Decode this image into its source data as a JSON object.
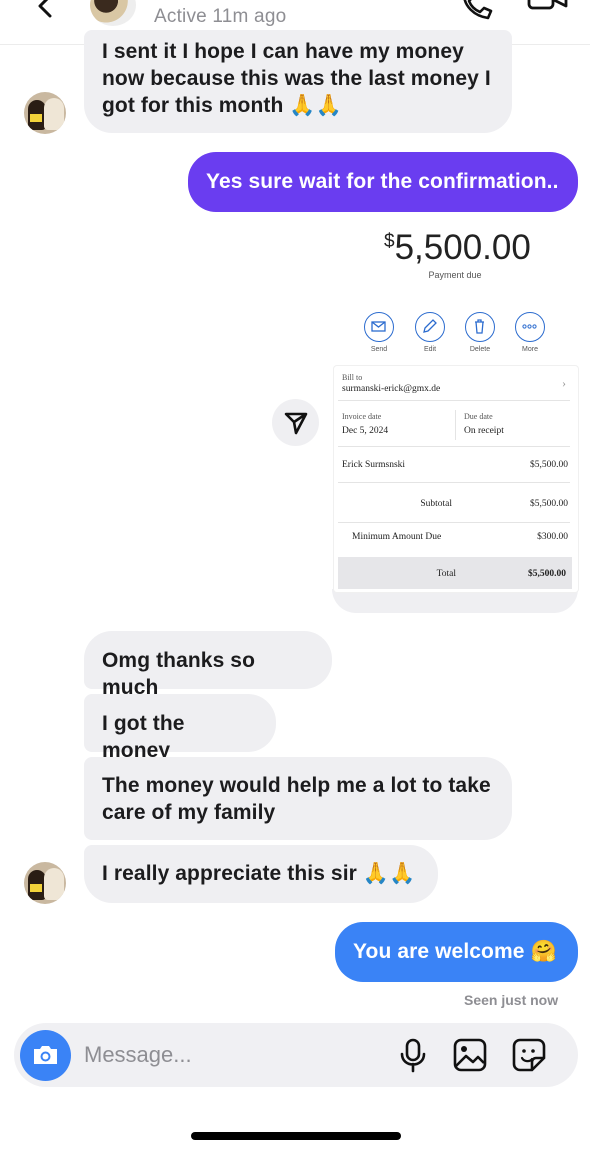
{
  "header": {
    "status": "Active 11m ago"
  },
  "messages": [
    {
      "from": "them",
      "lines": [
        "I sent it I hope I can have my money",
        "now because this was the last money I",
        "got for this month"
      ],
      "emoji": "🙏🙏"
    },
    {
      "from": "me",
      "text": "Yes sure wait for the confirmation.."
    },
    {
      "from": "them",
      "text": "Omg thanks so much"
    },
    {
      "from": "them",
      "text": "I got the money"
    },
    {
      "from": "them",
      "lines": [
        "The money would help me a lot to take",
        "care of my family"
      ]
    },
    {
      "from": "them",
      "text": "I really appreciate this sir",
      "emoji": "🙏🙏"
    },
    {
      "from": "me",
      "text": "You are welcome",
      "emoji": "🤗"
    }
  ],
  "invoice": {
    "currency_symbol": "$",
    "amount": "5,500.00",
    "payment_due_label": "Payment due",
    "actions": [
      "Send",
      "Edit",
      "Delete",
      "More"
    ],
    "bill_to_label": "Bill to",
    "bill_to_email": "surmanski-erick@gmx.de",
    "invoice_date_label": "Invoice date",
    "invoice_date": "Dec 5, 2024",
    "due_date_label": "Due date",
    "due_date": "On receipt",
    "line_item_name": "Erick Surmsnski",
    "line_item_amount": "$5,500.00",
    "subtotal_label": "Subtotal",
    "subtotal": "$5,500.00",
    "minimum_label": "Minimum Amount Due",
    "minimum": "$300.00",
    "total_label": "Total",
    "total": "$5,500.00"
  },
  "seen_status": "Seen just now",
  "composer": {
    "placeholder": "Message..."
  },
  "icons": {
    "header": [
      "back-arrow-icon",
      "phone-icon",
      "video-camera-icon"
    ],
    "composer": [
      "camera-icon",
      "microphone-icon",
      "gallery-icon",
      "sticker-icon"
    ]
  },
  "colors": {
    "purple_bubble": "#6a3df0",
    "blue_bubble": "#3a83f6",
    "incoming_bubble": "#efeff2"
  }
}
